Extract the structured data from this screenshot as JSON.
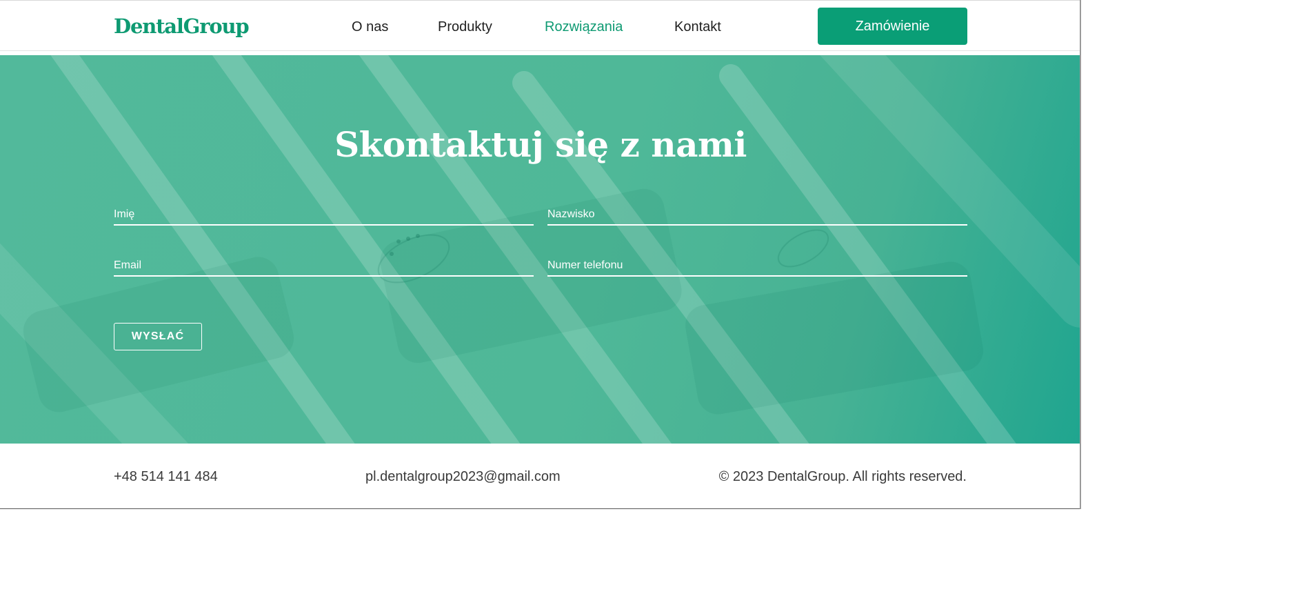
{
  "colors": {
    "brand": "#0e9a72",
    "button": "#0a9e76",
    "hero_overlay": "#4fb898"
  },
  "header": {
    "logo": "DentalGroup",
    "nav": [
      {
        "label": "O nas",
        "active": false
      },
      {
        "label": "Produkty",
        "active": false
      },
      {
        "label": "Rozwiązania",
        "active": true
      },
      {
        "label": "Kontakt",
        "active": false
      }
    ],
    "order_button": "Zamówienie"
  },
  "hero": {
    "title": "Skontaktuj się z nami",
    "form": {
      "first_name_placeholder": "Imię",
      "last_name_placeholder": "Nazwisko",
      "email_placeholder": "Email",
      "phone_placeholder": "Numer telefonu",
      "submit_label": "WYSŁAĆ"
    }
  },
  "footer": {
    "phone": "+48 514 141 484",
    "email": "pl.dentalgroup2023@gmail.com",
    "copyright": "© 2023 DentalGroup. All rights reserved."
  }
}
